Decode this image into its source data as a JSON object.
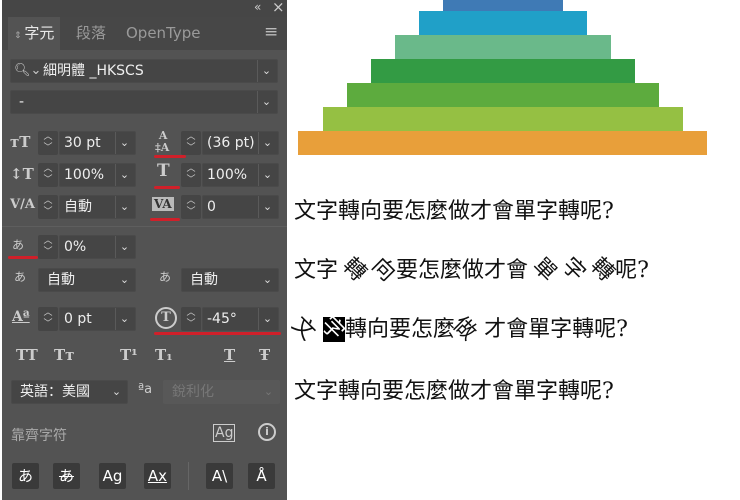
{
  "panel": {
    "collapse_icon": "«",
    "close_icon": "×",
    "tabs": [
      {
        "label": "字元",
        "active": true
      },
      {
        "label": "段落"
      },
      {
        "label": "OpenType"
      }
    ],
    "menu_icon": "≡",
    "font_family": "細明體 _HKSCS",
    "font_style": "-",
    "font_size": "30 pt",
    "leading": "(36 pt)",
    "vertical_scale": "100%",
    "horizontal_scale": "100%",
    "kerning": "自動",
    "tracking": "0",
    "tsume": "0%",
    "aki_left": "自動",
    "aki_right": "自動",
    "baseline_shift": "0 pt",
    "character_rotation": "-45°",
    "style_buttons": [
      "TT",
      "Tт",
      "T¹",
      "T₁",
      "T",
      "Ŧ"
    ],
    "language": "英語：美國",
    "anti_alias": "銳利化",
    "snap_label": "靠齊字符",
    "snap_buttons": [
      "あ",
      "あ",
      "Ag",
      "Ax",
      "A\\",
      "Å"
    ]
  },
  "canvas": {
    "pyramid_colors": [
      "#3f7ab5",
      "#20a0c8",
      "#6ab98a",
      "#339b44",
      "#5dab3e",
      "#95c043",
      "#e89f3a"
    ],
    "lines": [
      "文字轉向要怎麼做才會單字轉呢?",
      [
        "文字",
        "轉",
        "向",
        "要怎麼做才會",
        "單",
        "字",
        "轉",
        "呢?"
      ],
      [
        "文",
        "字",
        "轉向要怎麼",
        "做",
        "才會單字轉呢?"
      ],
      "文字轉向要怎麼做才會單字轉呢?"
    ]
  }
}
